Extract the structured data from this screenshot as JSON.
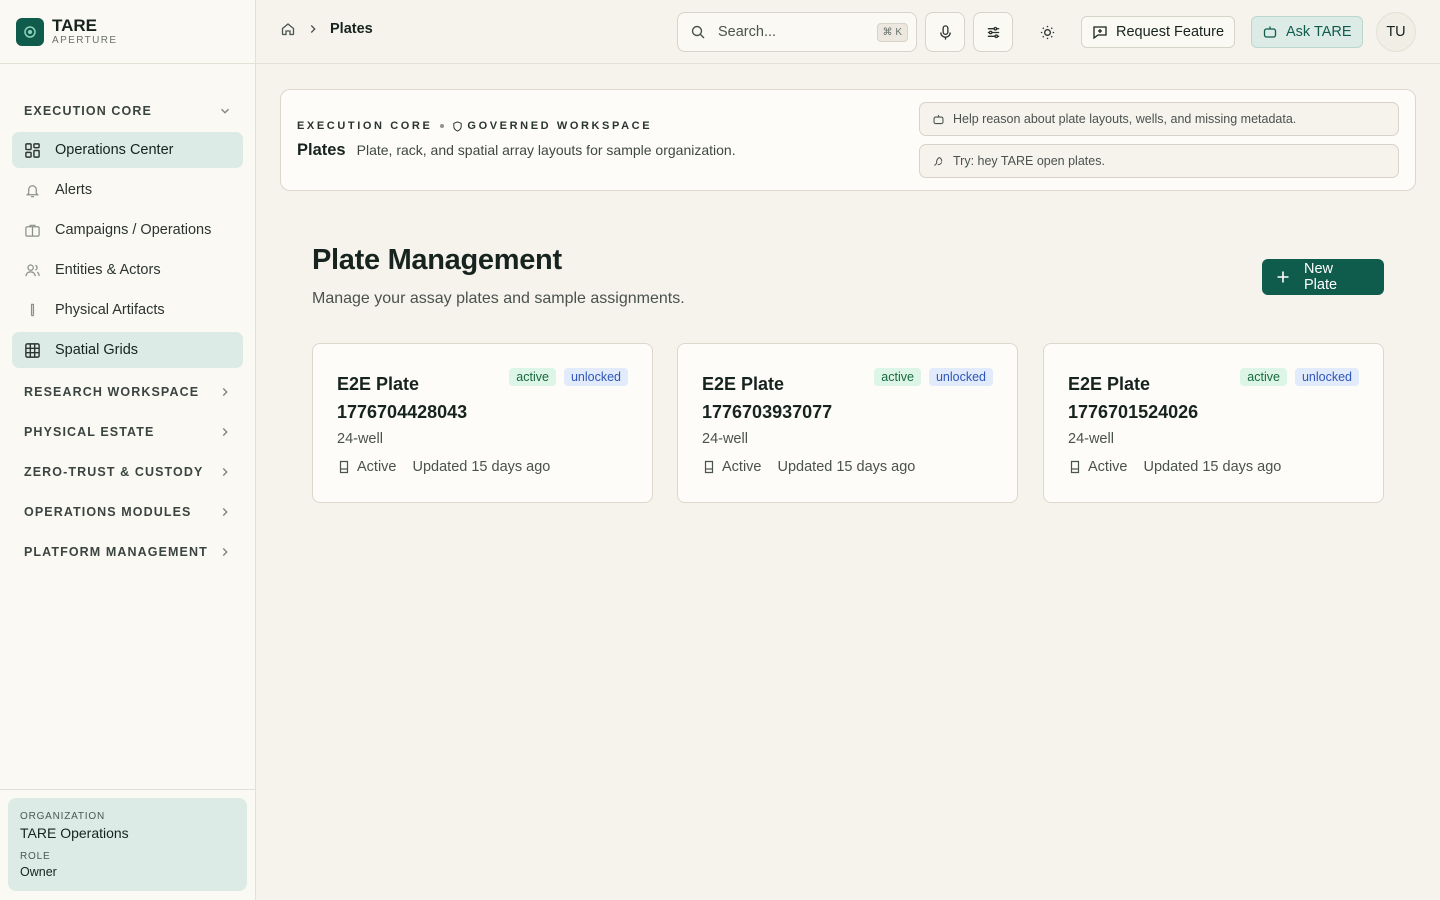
{
  "brand": {
    "name": "TARE",
    "subtitle": "APERTURE"
  },
  "sidebar": {
    "sections": [
      {
        "label": "EXECUTION CORE",
        "expanded": true
      },
      {
        "label": "RESEARCH WORKSPACE",
        "expanded": false
      },
      {
        "label": "PHYSICAL ESTATE",
        "expanded": false
      },
      {
        "label": "ZERO-TRUST & CUSTODY",
        "expanded": false
      },
      {
        "label": "OPERATIONS MODULES",
        "expanded": false
      },
      {
        "label": "PLATFORM MANAGEMENT",
        "expanded": false
      }
    ],
    "items": [
      {
        "label": "Operations Center",
        "icon": "dashboard-icon",
        "active": true
      },
      {
        "label": "Alerts",
        "icon": "bell-icon",
        "active": false
      },
      {
        "label": "Campaigns / Operations",
        "icon": "briefcase-icon",
        "active": false
      },
      {
        "label": "Entities & Actors",
        "icon": "users-icon",
        "active": false
      },
      {
        "label": "Physical Artifacts",
        "icon": "test-tube-icon",
        "active": false
      },
      {
        "label": "Spatial Grids",
        "icon": "grid-icon",
        "active": true
      }
    ],
    "org": {
      "org_label": "ORGANIZATION",
      "org_value": "TARE Operations",
      "role_label": "ROLE",
      "role_value": "Owner"
    }
  },
  "topbar": {
    "breadcrumb": {
      "current": "Plates"
    },
    "search": {
      "placeholder": "Search...",
      "shortcut": "⌘ K"
    },
    "request_feature": "Request Feature",
    "ask": "Ask TARE",
    "avatar": "TU"
  },
  "banner": {
    "eyebrow_left": "EXECUTION CORE",
    "eyebrow_right": "GOVERNED WORKSPACE",
    "title": "Plates",
    "description": "Plate, rack, and spatial array layouts for sample organization.",
    "hint_1": "Help reason about plate layouts, wells, and missing metadata.",
    "hint_2": "Try: hey TARE open plates."
  },
  "main": {
    "title": "Plate Management",
    "subtitle": "Manage your assay plates and sample assignments.",
    "new_button": "New Plate",
    "plates": [
      {
        "name": "E2E Plate 1776704428043",
        "status_badge": "active",
        "lock_badge": "unlocked",
        "type": "24-well",
        "status": "Active",
        "updated": "Updated 15 days ago"
      },
      {
        "name": "E2E Plate 1776703937077",
        "status_badge": "active",
        "lock_badge": "unlocked",
        "type": "24-well",
        "status": "Active",
        "updated": "Updated 15 days ago"
      },
      {
        "name": "E2E Plate 1776701524026",
        "status_badge": "active",
        "lock_badge": "unlocked",
        "type": "24-well",
        "status": "Active",
        "updated": "Updated 15 days ago"
      }
    ]
  },
  "colors": {
    "accent": "#0f5b4c",
    "active_nav": "#dcebe6",
    "background": "#f6f3ec"
  }
}
